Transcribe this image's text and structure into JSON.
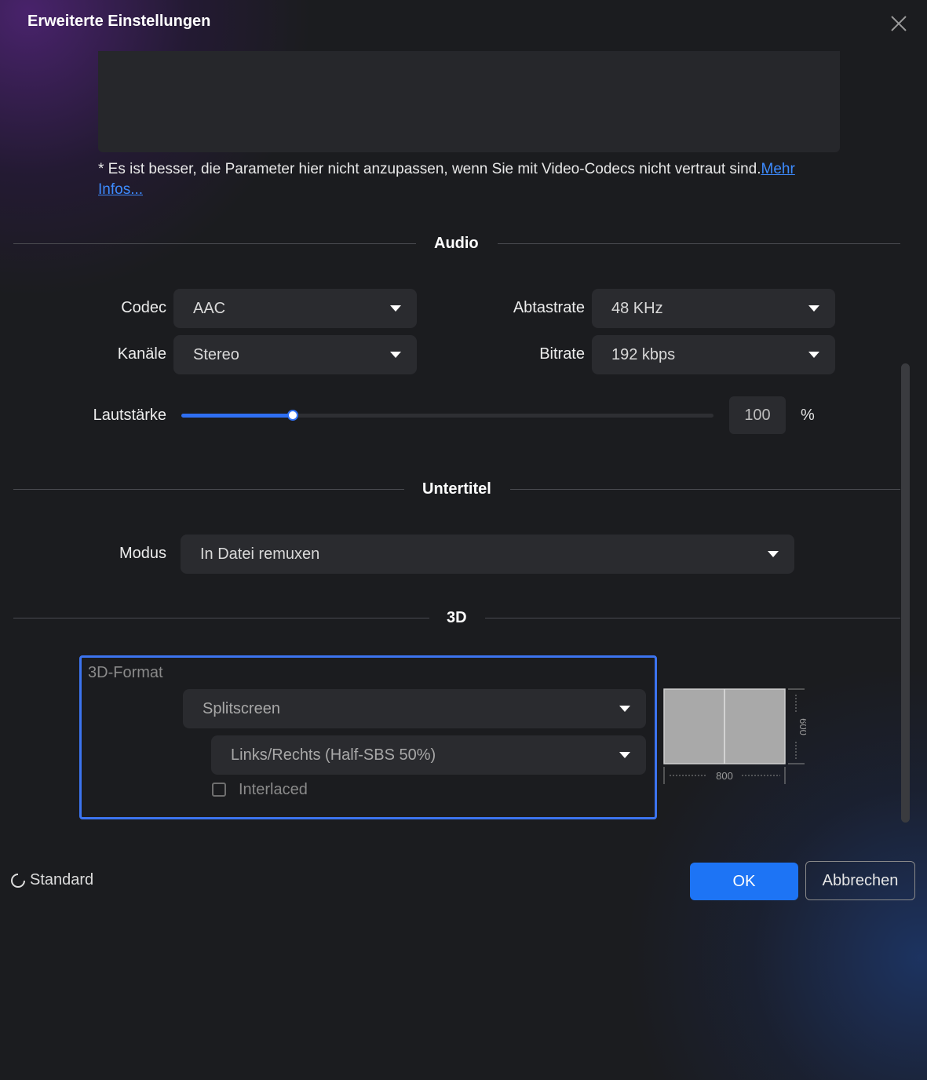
{
  "dialog": {
    "title": "Erweiterte Einstellungen",
    "note_text": "* Es ist besser, die Parameter hier nicht anzupassen, wenn Sie mit Video-Codecs nicht vertraut sind.",
    "note_link": "Mehr Infos..."
  },
  "audio": {
    "section_title": "Audio",
    "codec_label": "Codec",
    "codec_value": "AAC",
    "samplerate_label": "Abtastrate",
    "samplerate_value": "48 KHz",
    "channels_label": "Kanäle",
    "channels_value": "Stereo",
    "bitrate_label": "Bitrate",
    "bitrate_value": "192 kbps",
    "volume_label": "Lautstärke",
    "volume_value": "100",
    "volume_unit": "%",
    "volume_slider_fraction": 0.21
  },
  "subtitles": {
    "section_title": "Untertitel",
    "mode_label": "Modus",
    "mode_value": "In Datei remuxen"
  },
  "three_d": {
    "section_title": "3D",
    "format_label": "3D-Format",
    "format_value": "Splitscreen",
    "layout_value": "Links/Rechts (Half-SBS 50%)",
    "interlaced_label": "Interlaced",
    "interlaced_checked": false,
    "preview_width": "800",
    "preview_height": "600"
  },
  "footer": {
    "standard_label": "Standard",
    "ok_label": "OK",
    "cancel_label": "Abbrechen"
  },
  "colors": {
    "accent": "#1d74f5",
    "frame_highlight": "#3c74ef",
    "background": "#1b1c1f"
  }
}
